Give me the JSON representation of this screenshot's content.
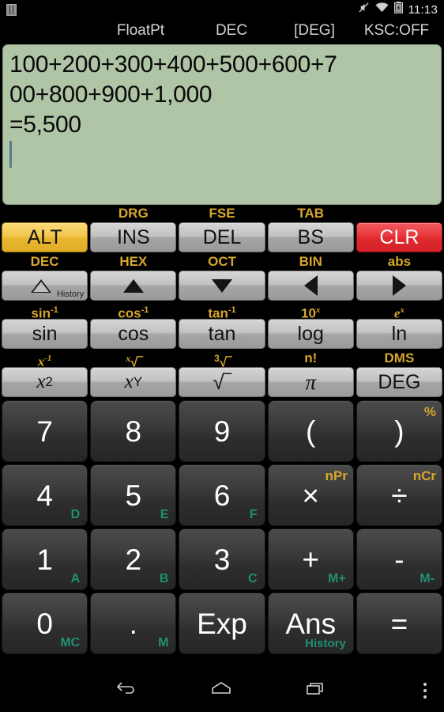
{
  "statusbar": {
    "notification_icon": "calculator-notification-icon",
    "mute_icon": "vibrate-mute-icon",
    "wifi_icon": "wifi-icon",
    "battery_icon": "battery-charging-icon",
    "time": "11:13"
  },
  "modebar": {
    "items": [
      {
        "label": "FloatPt",
        "name": "mode-floatpt"
      },
      {
        "label": "DEC",
        "name": "mode-base"
      },
      {
        "label": "[DEG]",
        "name": "mode-angle"
      },
      {
        "label": "KSC:OFF",
        "name": "mode-ksc"
      }
    ]
  },
  "display": {
    "lines": [
      "100+200+300+400+500+600+7",
      "00+800+900+1,000",
      "=5,500"
    ],
    "expression": "100+200+300+400+500+600+700+800+900+1,000",
    "result": "=5,500",
    "cursor_visible": true,
    "background_color": "#b0c4a6",
    "text_color": "#0a0a0a"
  },
  "function_rows": [
    {
      "name": "row-edit",
      "keys": [
        {
          "alt": "",
          "label": "ALT",
          "name": "alt-key",
          "style": "alt"
        },
        {
          "alt": "DRG",
          "label": "INS",
          "name": "ins-key",
          "style": "gray"
        },
        {
          "alt": "FSE",
          "label": "DEL",
          "name": "del-key",
          "style": "gray"
        },
        {
          "alt": "TAB",
          "label": "BS",
          "name": "bs-key",
          "style": "gray"
        },
        {
          "alt": "",
          "label": "CLR",
          "name": "clr-key",
          "style": "clr"
        }
      ]
    },
    {
      "name": "row-navigate",
      "keys": [
        {
          "alt": "DEC",
          "label": "History",
          "name": "history-key",
          "style": "gray"
        },
        {
          "alt": "HEX",
          "label": "",
          "name": "arrow-up-key",
          "style": "gray"
        },
        {
          "alt": "OCT",
          "label": "",
          "name": "arrow-down-key",
          "style": "gray"
        },
        {
          "alt": "BIN",
          "label": "",
          "name": "arrow-left-key",
          "style": "gray"
        },
        {
          "alt": "abs",
          "label": "",
          "name": "arrow-right-key",
          "style": "gray"
        }
      ]
    },
    {
      "name": "row-trig",
      "keys": [
        {
          "alt": "sin-1",
          "label": "sin",
          "name": "sin-key",
          "style": "gray"
        },
        {
          "alt": "cos-1",
          "label": "cos",
          "name": "cos-key",
          "style": "gray"
        },
        {
          "alt": "tan-1",
          "label": "tan",
          "name": "tan-key",
          "style": "gray"
        },
        {
          "alt": "10x",
          "label": "log",
          "name": "log-key",
          "style": "gray"
        },
        {
          "alt": "ex",
          "label": "ln",
          "name": "ln-key",
          "style": "gray"
        }
      ]
    },
    {
      "name": "row-power",
      "keys": [
        {
          "alt": "x-1",
          "label": "x2",
          "name": "x-squared-key",
          "style": "gray"
        },
        {
          "alt": "xroot",
          "label": "xY",
          "name": "x-power-y-key",
          "style": "gray"
        },
        {
          "alt": "3root",
          "label": "sqrt",
          "name": "sqrt-key",
          "style": "gray"
        },
        {
          "alt": "n!",
          "label": "pi",
          "name": "pi-key",
          "style": "gray"
        },
        {
          "alt": "DMS",
          "label": "DEG",
          "name": "deg-key",
          "style": "gray"
        }
      ]
    }
  ],
  "keypad": [
    [
      {
        "main": "7",
        "tr": "",
        "br": "",
        "name": "key-7"
      },
      {
        "main": "8",
        "tr": "",
        "br": "",
        "name": "key-8"
      },
      {
        "main": "9",
        "tr": "",
        "br": "",
        "name": "key-9"
      },
      {
        "main": "(",
        "tr": "",
        "br": "",
        "name": "key-open-paren"
      },
      {
        "main": ")",
        "tr": "%",
        "br": "",
        "name": "key-close-paren"
      }
    ],
    [
      {
        "main": "4",
        "tr": "",
        "br": "D",
        "name": "key-4"
      },
      {
        "main": "5",
        "tr": "",
        "br": "E",
        "name": "key-5"
      },
      {
        "main": "6",
        "tr": "",
        "br": "F",
        "name": "key-6"
      },
      {
        "main": "×",
        "tr": "nPr",
        "br": "",
        "name": "key-multiply"
      },
      {
        "main": "÷",
        "tr": "nCr",
        "br": "",
        "name": "key-divide"
      }
    ],
    [
      {
        "main": "1",
        "tr": "",
        "br": "A",
        "name": "key-1"
      },
      {
        "main": "2",
        "tr": "",
        "br": "B",
        "name": "key-2"
      },
      {
        "main": "3",
        "tr": "",
        "br": "C",
        "name": "key-3"
      },
      {
        "main": "+",
        "tr": "",
        "br": "M+",
        "name": "key-plus"
      },
      {
        "main": "-",
        "tr": "",
        "br": "M-",
        "name": "key-minus"
      }
    ],
    [
      {
        "main": "0",
        "tr": "",
        "br": "MC",
        "name": "key-0"
      },
      {
        "main": ".",
        "tr": "",
        "br": "M",
        "name": "key-decimal"
      },
      {
        "main": "Exp",
        "tr": "",
        "br": "",
        "name": "key-exp"
      },
      {
        "main": "Ans",
        "tr": "",
        "br": "History",
        "name": "key-ans"
      },
      {
        "main": "=",
        "tr": "",
        "br": "",
        "name": "key-equals"
      }
    ]
  ],
  "navbar": {
    "back_icon": "back-arrow-icon",
    "home_icon": "home-icon",
    "recents_icon": "recent-apps-icon",
    "menu_icon": "overflow-menu-icon"
  },
  "colors": {
    "accent_gold": "#d7a62c",
    "accent_teal": "#1f8f72",
    "alt_amber": "#f2c74e",
    "clr_red": "#e02a30",
    "display_green": "#b0c4a6"
  }
}
